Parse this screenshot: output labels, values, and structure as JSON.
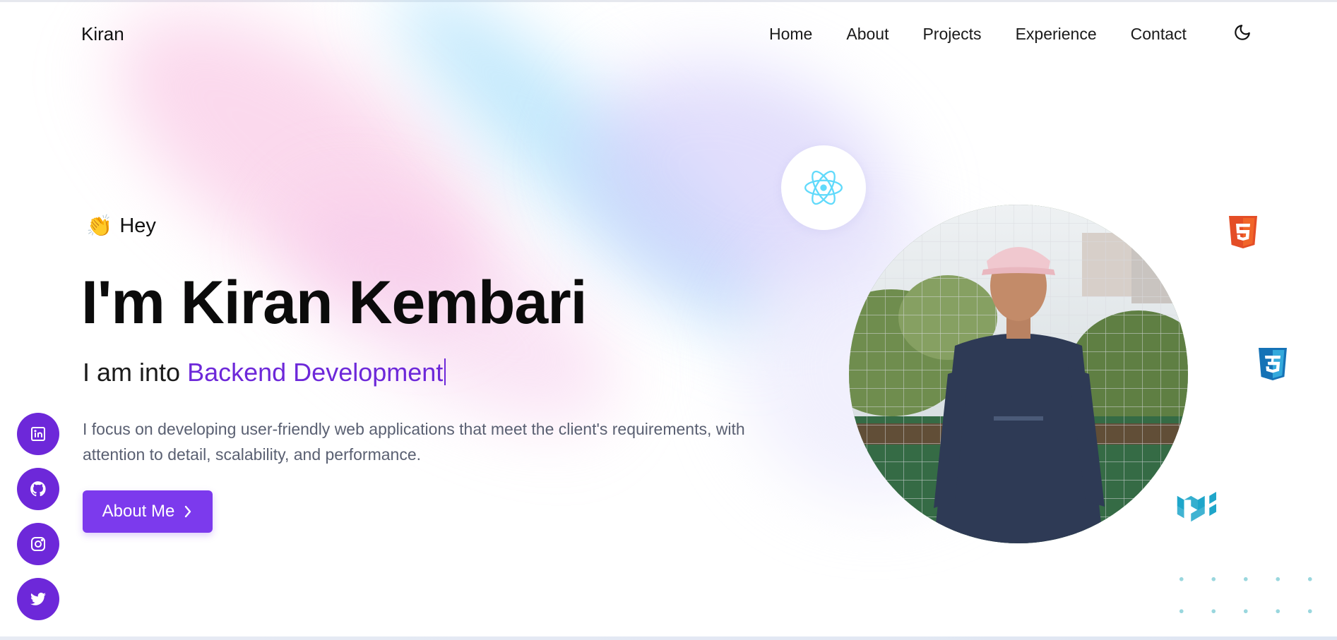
{
  "nav": {
    "brand": "Kiran",
    "links": [
      "Home",
      "About",
      "Projects",
      "Experience",
      "Contact"
    ],
    "theme_icon": "moon-icon"
  },
  "hero": {
    "greeting_emoji": "👏",
    "greeting": "Hey",
    "headline": "I'm Kiran Kembari",
    "subhead_prefix": "I am into",
    "subhead_accent": "Backend Development",
    "description": "I focus on developing user-friendly web applications that meet the client's requirements, with attention to detail, scalability, and performance.",
    "cta_label": "About Me"
  },
  "socials": [
    "linkedin-icon",
    "github-icon",
    "instagram-icon",
    "twitter-icon"
  ],
  "tech_icons": [
    "react-icon",
    "html5-icon",
    "css3-icon",
    "mui-icon"
  ],
  "colors": {
    "accent": "#7c3aed",
    "accent_dark": "#6d28d9",
    "text": "#111111",
    "muted": "#5a6072"
  }
}
